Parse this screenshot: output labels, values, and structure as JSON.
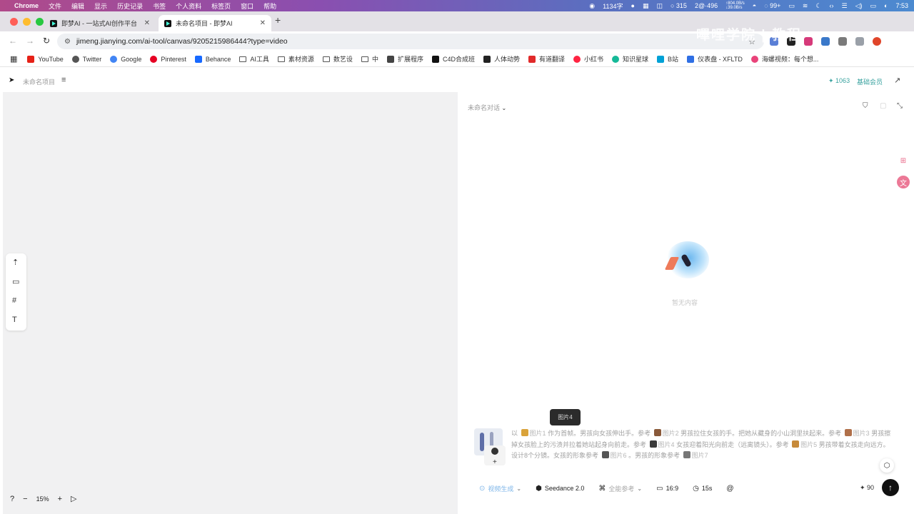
{
  "menubar": {
    "app_name": "Chrome",
    "items": [
      "文件",
      "编辑",
      "显示",
      "历史记录",
      "书签",
      "个人资料",
      "标签页",
      "窗口",
      "帮助"
    ],
    "status": {
      "word_count": "1134字",
      "badge_a": "315",
      "badge_b": "2@·496",
      "net_up": "804.0B/s",
      "net_down": "39.0B/s",
      "wechat": "99+",
      "time": "7:53"
    }
  },
  "tabs": [
    {
      "label": "即梦AI - 一站式AI创作平台",
      "active": false
    },
    {
      "label": "未命名项目 - 即梦AI",
      "active": true
    }
  ],
  "address": {
    "url": "jimeng.jianying.com/ai-tool/canvas/9205215986444?type=video"
  },
  "watermark": "嗶哩学院 | 教程",
  "bookmarks": [
    {
      "label": "YouTube",
      "icon": "youtube-icon",
      "color": "#e62117"
    },
    {
      "label": "Twitter",
      "icon": "globe-icon",
      "color": "#555555"
    },
    {
      "label": "Google",
      "icon": "google-icon",
      "color": "#4285f4"
    },
    {
      "label": "Pinterest",
      "icon": "pinterest-icon",
      "color": "#e60023"
    },
    {
      "label": "Behance",
      "icon": "behance-icon",
      "color": "#1769ff"
    },
    {
      "label": "AI工具",
      "icon": "folder-icon",
      "color": ""
    },
    {
      "label": "素材资源",
      "icon": "folder-icon",
      "color": ""
    },
    {
      "label": "数艺设",
      "icon": "folder-icon",
      "color": ""
    },
    {
      "label": "中",
      "icon": "folder-icon",
      "color": ""
    },
    {
      "label": "扩展程序",
      "icon": "puzzle-icon",
      "color": "#444444"
    },
    {
      "label": "C4D合成班",
      "icon": "c4d-icon",
      "color": "#111111"
    },
    {
      "label": "人体动势",
      "icon": "p-icon",
      "color": "#222222"
    },
    {
      "label": "有道翻译",
      "icon": "youdao-icon",
      "color": "#e12a2a"
    },
    {
      "label": "小红书",
      "icon": "xiaohongshu-icon",
      "color": "#ff2442"
    },
    {
      "label": "知识星球",
      "icon": "planet-icon",
      "color": "#16b998"
    },
    {
      "label": "B站",
      "icon": "bilibili-icon",
      "color": "#00a1d6"
    },
    {
      "label": "仪表盘 - XFLTD",
      "icon": "dashboard-icon",
      "color": "#2f6fe4"
    },
    {
      "label": "海螺视频：每个想...",
      "icon": "hailuo-icon",
      "color": "#e9437a"
    }
  ],
  "app_header": {
    "project_name": "未命名项目",
    "credits": "1063",
    "member": "基础会员"
  },
  "canvas": {
    "zoom": "15%"
  },
  "panel": {
    "conversation_title": "未命名对话",
    "empty_text": "暂无内容",
    "tooltip": "图片4",
    "prompt_segments": [
      {
        "text": "以",
        "ref": false
      },
      {
        "text": "图片1",
        "ref": true,
        "color": "#d9a33a"
      },
      {
        "text": "作为首帧。男孩向女孩伸出手。参考",
        "ref": false
      },
      {
        "text": "图片2",
        "ref": true,
        "color": "#8a5a3a"
      },
      {
        "text": "男孩拉住女孩的手。把她从藏身的小山洞里扶起来。参考",
        "ref": false
      },
      {
        "text": "图片3",
        "ref": true,
        "color": "#b0704a"
      },
      {
        "text": "男孩擦掉女孩脸上的污渍并拉着她站起身向前走。参考",
        "ref": false
      },
      {
        "text": "图片4",
        "ref": true,
        "color": "#3a3a3a"
      },
      {
        "text": "女孩迎着阳光向前走（远离镜头）。参考",
        "ref": false
      },
      {
        "text": "图片5",
        "ref": true,
        "color": "#c78a3a"
      },
      {
        "text": "男孩带着女孩走向远方。设计8个分镜。女孩的形象参考",
        "ref": false
      },
      {
        "text": "图片6",
        "ref": true,
        "color": "#555555"
      },
      {
        "text": "。男孩的形象参考",
        "ref": false
      },
      {
        "text": "图片7",
        "ref": true,
        "color": "#777777"
      }
    ],
    "controls": {
      "mode": "视频生成",
      "model": "Seedance 2.0",
      "reference": "全能参考",
      "ratio": "16:9",
      "duration": "15s",
      "cost": "90"
    }
  }
}
